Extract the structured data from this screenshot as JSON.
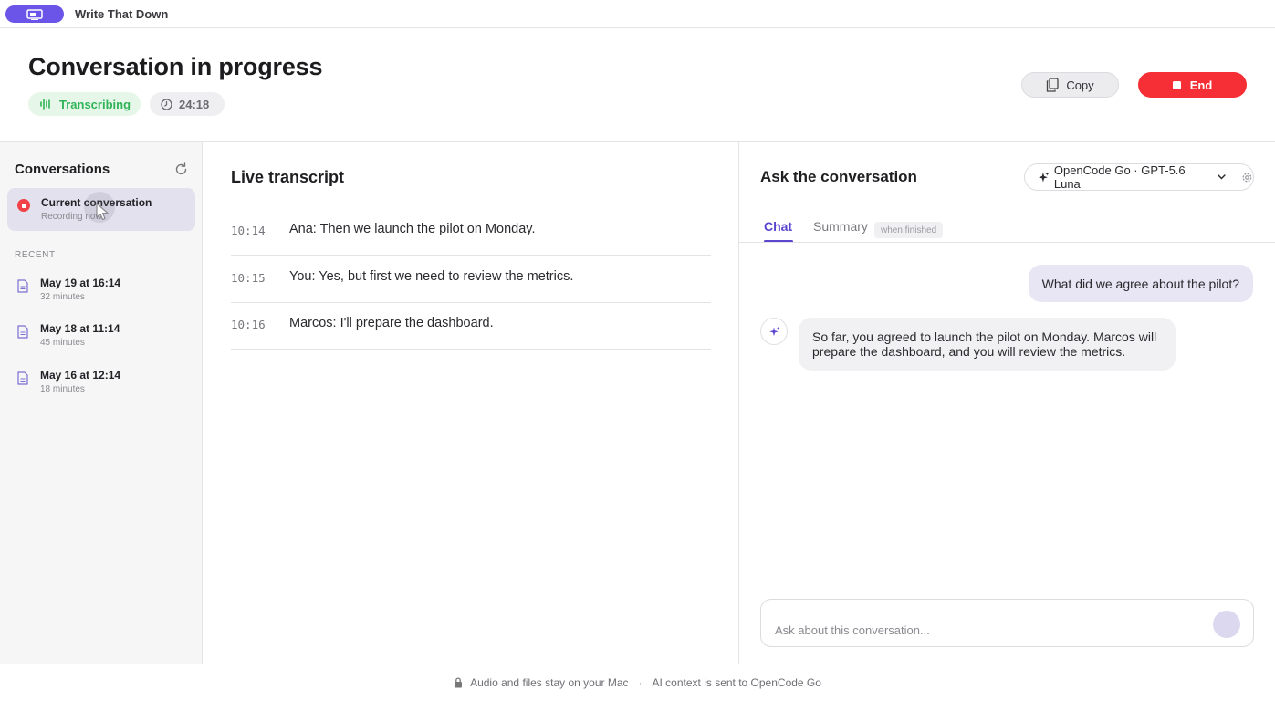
{
  "app": {
    "title": "Write That Down",
    "accent_color": "#6b55e8"
  },
  "header": {
    "title": "Conversation in progress",
    "status_badge": "Transcribing",
    "status_color": "#2fb356",
    "timer": "24:18",
    "copy_label": "Copy",
    "end_label": "End",
    "end_color": "#f52f35"
  },
  "sidebar": {
    "title": "Conversations",
    "current": {
      "title": "Current conversation",
      "subtitle": "Recording now"
    },
    "recent_label": "RECENT",
    "recent": [
      {
        "title": "May 19 at 16:14",
        "duration": "32 minutes"
      },
      {
        "title": "May 18 at 11:14",
        "duration": "45 minutes"
      },
      {
        "title": "May 16 at 12:14",
        "duration": "18 minutes"
      }
    ]
  },
  "transcript": {
    "title": "Live transcript",
    "lines": [
      {
        "time": "10:14",
        "text": "Ana: Then we launch the pilot on Monday."
      },
      {
        "time": "10:15",
        "text": "You: Yes, but first we need to review the metrics."
      },
      {
        "time": "10:16",
        "text": "Marcos: I'll prepare the dashboard."
      }
    ]
  },
  "ask": {
    "title": "Ask the conversation",
    "model": "OpenCode Go · GPT-5.6 Luna",
    "tabs": {
      "chat": "Chat",
      "summary": "Summary",
      "summary_note": "when finished"
    },
    "messages": {
      "user": "What did we agree about the pilot?",
      "assistant": "So far, you agreed to launch the pilot on Monday. Marcos will prepare the dashboard, and you will review the metrics."
    },
    "composer_placeholder": "Ask about this conversation..."
  },
  "footer": {
    "privacy": "Audio and files stay on your Mac",
    "ai_context": "AI context is sent to OpenCode Go"
  }
}
